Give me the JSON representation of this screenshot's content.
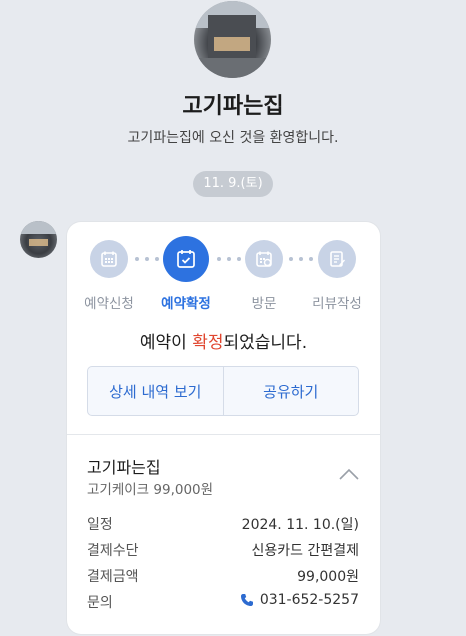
{
  "store": {
    "name": "고기파는집",
    "greeting": "고기파는집에 오신 것을 환영합니다."
  },
  "chat": {
    "date": "11. 9.(토)"
  },
  "steps": [
    {
      "label": "예약신청",
      "icon": "calendar-icon",
      "active": false
    },
    {
      "label": "예약확정",
      "icon": "calendar-check-icon",
      "active": true
    },
    {
      "label": "방문",
      "icon": "calendar-visit-icon",
      "active": false
    },
    {
      "label": "리뷰작성",
      "icon": "edit-note-icon",
      "active": false
    }
  ],
  "message": {
    "pre": "예약이 ",
    "highlight": "확정",
    "post": "되었습니다."
  },
  "buttons": {
    "details": "상세 내역 보기",
    "share": "공유하기"
  },
  "detail": {
    "store_name": "고기파는집",
    "product": "고기케이크 99,000원",
    "rows": [
      {
        "key": "일정",
        "value": "2024. 11. 10.(일)"
      },
      {
        "key": "결제수단",
        "value": "신용카드 간편결제"
      },
      {
        "key": "결제금액",
        "value": "99,000원"
      },
      {
        "key": "문의",
        "value": "031-652-5257"
      }
    ]
  },
  "colors": {
    "accent": "#2d72e0",
    "highlight": "#e0462f",
    "background": "#e7eaef"
  }
}
